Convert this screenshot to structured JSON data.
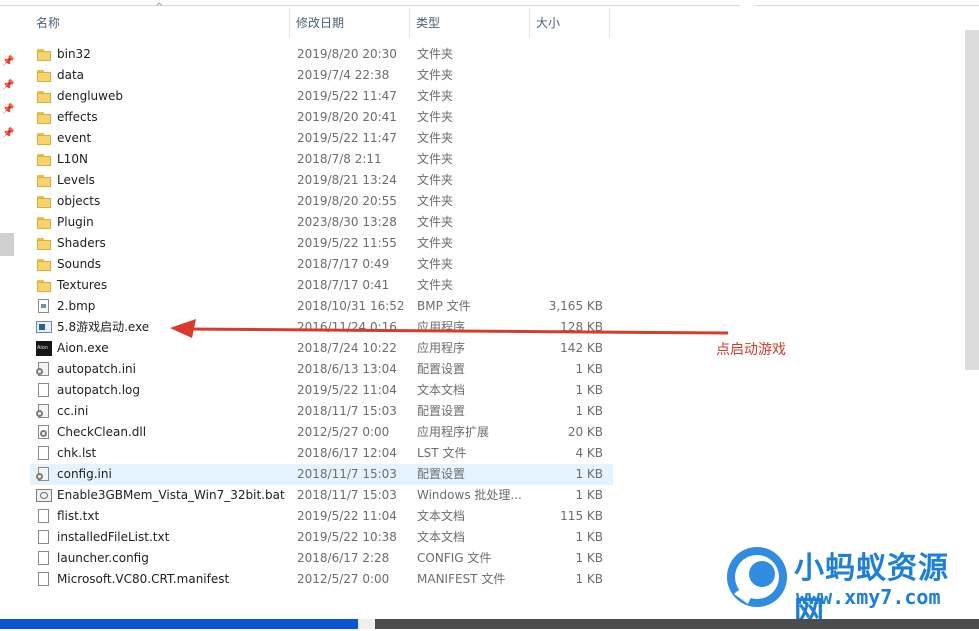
{
  "header": {
    "sort_arrow": "^",
    "columns": [
      {
        "key": "name",
        "label": "名称"
      },
      {
        "key": "date",
        "label": "修改日期"
      },
      {
        "key": "type",
        "label": "类型"
      },
      {
        "key": "size",
        "label": "大小"
      }
    ]
  },
  "files": [
    {
      "name": "bin32",
      "date": "2019/8/20 20:30",
      "type": "文件夹",
      "size": "",
      "icon": "folder-icon"
    },
    {
      "name": "data",
      "date": "2019/7/4 22:38",
      "type": "文件夹",
      "size": "",
      "icon": "folder-icon"
    },
    {
      "name": "dengluweb",
      "date": "2019/5/22 11:47",
      "type": "文件夹",
      "size": "",
      "icon": "folder-icon"
    },
    {
      "name": "effects",
      "date": "2019/8/20 20:41",
      "type": "文件夹",
      "size": "",
      "icon": "folder-icon"
    },
    {
      "name": "event",
      "date": "2019/5/22 11:47",
      "type": "文件夹",
      "size": "",
      "icon": "folder-icon"
    },
    {
      "name": "L10N",
      "date": "2018/7/8 2:11",
      "type": "文件夹",
      "size": "",
      "icon": "folder-icon"
    },
    {
      "name": "Levels",
      "date": "2019/8/21 13:24",
      "type": "文件夹",
      "size": "",
      "icon": "folder-icon"
    },
    {
      "name": "objects",
      "date": "2019/8/20 20:55",
      "type": "文件夹",
      "size": "",
      "icon": "folder-icon"
    },
    {
      "name": "Plugin",
      "date": "2023/8/30 13:28",
      "type": "文件夹",
      "size": "",
      "icon": "folder-icon"
    },
    {
      "name": "Shaders",
      "date": "2019/5/22 11:55",
      "type": "文件夹",
      "size": "",
      "icon": "folder-icon"
    },
    {
      "name": "Sounds",
      "date": "2018/7/17 0:49",
      "type": "文件夹",
      "size": "",
      "icon": "folder-icon"
    },
    {
      "name": "Textures",
      "date": "2018/7/17 0:41",
      "type": "文件夹",
      "size": "",
      "icon": "folder-icon"
    },
    {
      "name": "2.bmp",
      "date": "2018/10/31 16:52",
      "type": "BMP 文件",
      "size": "3,165 KB",
      "icon": "bmp-file-icon"
    },
    {
      "name": "5.8游戏启动.exe",
      "date": "2016/11/24 0:16",
      "type": "应用程序",
      "size": "128 KB",
      "icon": "app-exe-icon"
    },
    {
      "name": "Aion.exe",
      "date": "2018/7/24 10:22",
      "type": "应用程序",
      "size": "142 KB",
      "icon": "aion-exe-icon"
    },
    {
      "name": "autopatch.ini",
      "date": "2018/6/13 13:04",
      "type": "配置设置",
      "size": "1 KB",
      "icon": "config-file-icon"
    },
    {
      "name": "autopatch.log",
      "date": "2019/5/22 11:04",
      "type": "文本文档",
      "size": "1 KB",
      "icon": "text-file-icon"
    },
    {
      "name": "cc.ini",
      "date": "2018/11/7 15:03",
      "type": "配置设置",
      "size": "1 KB",
      "icon": "config-file-icon"
    },
    {
      "name": "CheckClean.dll",
      "date": "2012/5/27 0:00",
      "type": "应用程序扩展",
      "size": "20 KB",
      "icon": "dll-file-icon"
    },
    {
      "name": "chk.lst",
      "date": "2018/6/17 12:04",
      "type": "LST 文件",
      "size": "4 KB",
      "icon": "text-file-icon"
    },
    {
      "name": "config.ini",
      "date": "2018/11/7 15:03",
      "type": "配置设置",
      "size": "1 KB",
      "icon": "config-file-icon",
      "highlighted": true
    },
    {
      "name": "Enable3GBMem_Vista_Win7_32bit.bat",
      "date": "2018/11/7 15:03",
      "type": "Windows 批处理...",
      "size": "1 KB",
      "icon": "batch-file-icon"
    },
    {
      "name": "flist.txt",
      "date": "2019/5/22 11:04",
      "type": "文本文档",
      "size": "115 KB",
      "icon": "text-file-icon"
    },
    {
      "name": "installedFileList.txt",
      "date": "2019/5/22 10:38",
      "type": "文本文档",
      "size": "1 KB",
      "icon": "text-file-icon"
    },
    {
      "name": "launcher.config",
      "date": "2018/6/17 2:28",
      "type": "CONFIG 文件",
      "size": "1 KB",
      "icon": "text-file-icon"
    },
    {
      "name": "Microsoft.VC80.CRT.manifest",
      "date": "2012/5/27 0:00",
      "type": "MANIFEST 文件",
      "size": "1 KB",
      "icon": "text-file-icon"
    }
  ],
  "annotation": {
    "label": "点启动游戏",
    "color": "#d83b2c"
  },
  "watermark": {
    "title": "小蚂蚁资源网",
    "url": "www.xmy7.com",
    "color": "#1e7fd8"
  }
}
